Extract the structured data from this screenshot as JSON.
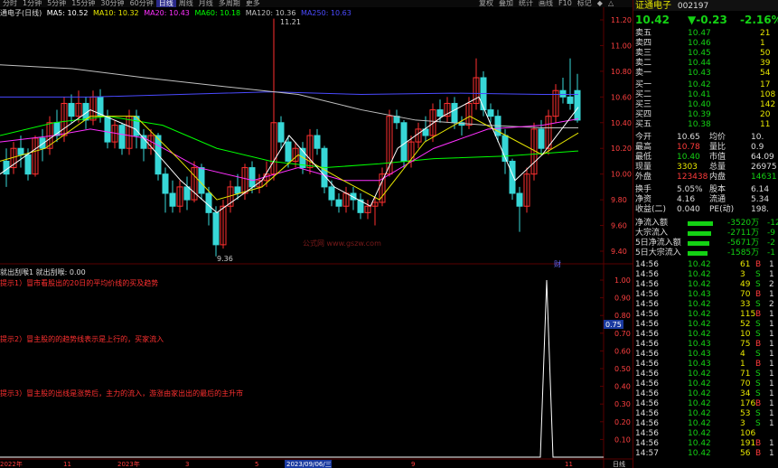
{
  "top_tabs": [
    "分时",
    "1分钟",
    "5分钟",
    "15分钟",
    "30分钟",
    "60分钟",
    "日线",
    "周线",
    "月线",
    "多周期",
    "更多"
  ],
  "active_tab": "日线",
  "top_right_buttons": [
    "复权",
    "叠加",
    "统计",
    "画线",
    "F10",
    "标记",
    "◆",
    "△"
  ],
  "ma_bar": {
    "stock": "通电子(日线)",
    "ma5": "MA5: 10.52",
    "ma10": "MA10: 10.32",
    "ma20": "MA20: 10.43",
    "ma60": "MA60: 10.18",
    "ma120": "MA120: 10.36",
    "ma250": "MA250: 10.63",
    "colors": {
      "ma5": "#ffffff",
      "ma10": "#e8e800",
      "ma20": "#ff30ff",
      "ma60": "#00ff00",
      "ma120": "#c0c0c0",
      "ma250": "#4a4aff"
    }
  },
  "price_axis": [
    "11.20",
    "11.00",
    "10.80",
    "10.60",
    "10.40",
    "10.20",
    "10.00",
    "9.80",
    "9.60",
    "9.40"
  ],
  "high_marker": "11.21",
  "low_marker": "9.36",
  "watermark": "公式网 www.gszw.com",
  "cai_label": "财",
  "indicator": {
    "title": "就出刮喉1 就出刮喉: 0.00",
    "notes": [
      "提示1）冒市看股出的20日的平均价线的买及趋势",
      "提示2）冒主股的的趋势线表示是上行的，买家流入",
      "提示3）冒主股的出线是涨势后，主力的流入，游涨由家出出的最后的主升市"
    ],
    "axis": [
      "1.00",
      "0.90",
      "0.80",
      "0.75",
      "0.70",
      "0.60",
      "0.50",
      "0.40",
      "0.30",
      "0.20",
      "0.10"
    ],
    "current": "0.75"
  },
  "date_axis": [
    "2022年",
    "11",
    "2023年",
    "3",
    "5",
    "7",
    "9",
    "2023/09/06/三",
    "11"
  ],
  "quote": {
    "name": "证通电子",
    "code": "002197",
    "price": "10.42",
    "change": "▼-0.23",
    "pct": "-2.16%",
    "asks": [
      {
        "label": "卖五",
        "price": "10.47",
        "vol": "21"
      },
      {
        "label": "卖四",
        "price": "10.46",
        "vol": "1"
      },
      {
        "label": "卖三",
        "price": "10.45",
        "vol": "50"
      },
      {
        "label": "卖二",
        "price": "10.44",
        "vol": "39"
      },
      {
        "label": "卖一",
        "price": "10.43",
        "vol": "54"
      }
    ],
    "bids": [
      {
        "label": "买一",
        "price": "10.42",
        "vol": "17"
      },
      {
        "label": "买二",
        "price": "10.41",
        "vol": "108"
      },
      {
        "label": "买三",
        "price": "10.40",
        "vol": "142"
      },
      {
        "label": "买四",
        "price": "10.39",
        "vol": "20"
      },
      {
        "label": "买五",
        "price": "10.38",
        "vol": "11"
      }
    ],
    "stats": [
      {
        "l1": "今开",
        "v1": "10.65",
        "l2": "均价",
        "v2": "10."
      },
      {
        "l1": "最高",
        "v1": "10.78",
        "l2": "量比",
        "v2": "0.9"
      },
      {
        "l1": "最低",
        "v1": "10.40",
        "l2": "市值",
        "v2": "64.09"
      },
      {
        "l1": "现量",
        "v1": "3303",
        "l2": "总量",
        "v2": "26975"
      },
      {
        "l1": "外盘",
        "v1": "123438",
        "l2": "内盘",
        "v2": "14631"
      }
    ],
    "stats2": [
      {
        "l1": "换手",
        "v1": "5.05%",
        "l2": "股本",
        "v2": "6.14"
      },
      {
        "l1": "净资",
        "v1": "4.16",
        "l2": "流通",
        "v2": "5.34"
      },
      {
        "l1": "收益(二)",
        "v1": "0.040",
        "l2": "PE(动)",
        "v2": "198."
      }
    ],
    "flows": [
      {
        "label": "净流入额",
        "value": "-3520万",
        "tail": "-12"
      },
      {
        "label": "大宗流入",
        "value": "-2711万",
        "tail": "-9"
      },
      {
        "label": "5日净流入额",
        "value": "-5671万",
        "tail": "-2"
      },
      {
        "label": "5日大宗流入",
        "value": "-1585万",
        "tail": "-1"
      }
    ],
    "ticks": [
      {
        "t": "14:56",
        "p": "10.42",
        "v": "61",
        "d": "B",
        "s": "1"
      },
      {
        "t": "14:56",
        "p": "10.42",
        "v": "3",
        "d": "S",
        "s": "1"
      },
      {
        "t": "14:56",
        "p": "10.42",
        "v": "49",
        "d": "S",
        "s": "2"
      },
      {
        "t": "14:56",
        "p": "10.43",
        "v": "70",
        "d": "B",
        "s": "1"
      },
      {
        "t": "14:56",
        "p": "10.42",
        "v": "33",
        "d": "S",
        "s": "2"
      },
      {
        "t": "14:56",
        "p": "10.42",
        "v": "115",
        "d": "B",
        "s": "1"
      },
      {
        "t": "14:56",
        "p": "10.42",
        "v": "52",
        "d": "S",
        "s": "1"
      },
      {
        "t": "14:56",
        "p": "10.42",
        "v": "10",
        "d": "S",
        "s": "1"
      },
      {
        "t": "14:56",
        "p": "10.43",
        "v": "75",
        "d": "B",
        "s": "1"
      },
      {
        "t": "14:56",
        "p": "10.43",
        "v": "4",
        "d": "S",
        "s": "1"
      },
      {
        "t": "14:56",
        "p": "10.43",
        "v": "1",
        "d": "B",
        "s": "1"
      },
      {
        "t": "14:56",
        "p": "10.42",
        "v": "71",
        "d": "S",
        "s": "1"
      },
      {
        "t": "14:56",
        "p": "10.42",
        "v": "70",
        "d": "S",
        "s": "1"
      },
      {
        "t": "14:56",
        "p": "10.42",
        "v": "34",
        "d": "S",
        "s": "1"
      },
      {
        "t": "14:56",
        "p": "10.42",
        "v": "176",
        "d": "B",
        "s": "1"
      },
      {
        "t": "14:56",
        "p": "10.42",
        "v": "53",
        "d": "S",
        "s": "1"
      },
      {
        "t": "14:56",
        "p": "10.42",
        "v": "3",
        "d": "S",
        "s": "1"
      },
      {
        "t": "14:56",
        "p": "10.42",
        "v": "106",
        "d": "",
        "s": ""
      },
      {
        "t": "14:56",
        "p": "10.42",
        "v": "191",
        "d": "B",
        "s": "1"
      },
      {
        "t": "14:57",
        "p": "10.42",
        "v": "56",
        "d": "B",
        "s": "1"
      }
    ]
  }
}
